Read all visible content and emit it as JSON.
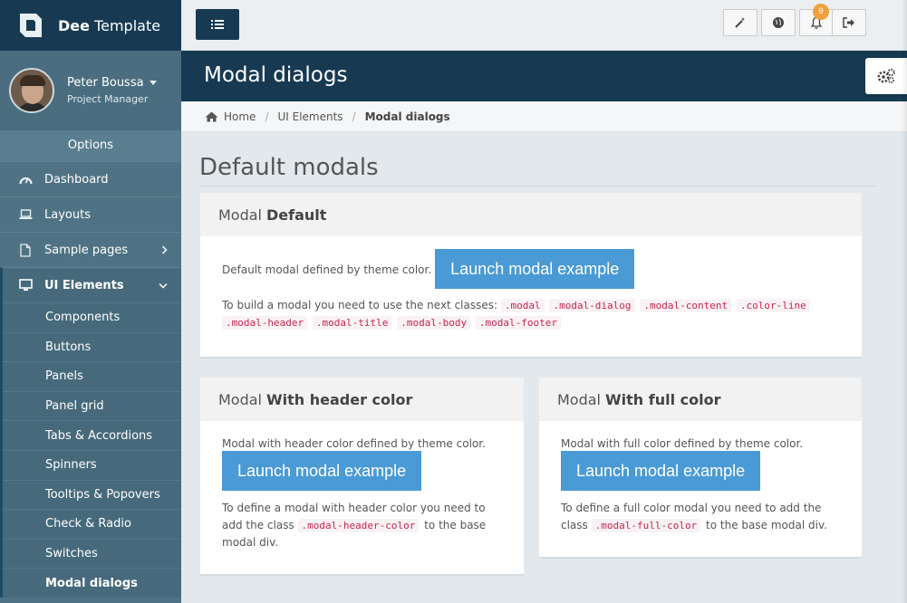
{
  "brand": {
    "name_bold": "Dee",
    "name_rest": " Template"
  },
  "profile": {
    "name": "Peter Boussa",
    "role": "Project Manager"
  },
  "sidebar": {
    "options_label": "Options",
    "items": [
      {
        "label": "Dashboard",
        "icon": "dashboard-icon"
      },
      {
        "label": "Layouts",
        "icon": "laptop-icon"
      },
      {
        "label": "Sample pages",
        "icon": "file-icon"
      },
      {
        "label": "UI Elements",
        "icon": "monitor-icon"
      }
    ],
    "sub_items": [
      "Components",
      "Buttons",
      "Panels",
      "Panel grid",
      "Tabs & Accordions",
      "Spinners",
      "Tooltips & Popovers",
      "Check & Radio",
      "Switches",
      "Modal dialogs"
    ]
  },
  "topbar": {
    "notification_count": "9"
  },
  "page": {
    "title": "Modal dialogs"
  },
  "breadcrumb": {
    "home": "Home",
    "parent": "UI Elements",
    "current": "Modal dialogs"
  },
  "content": {
    "section_title": "Default modals",
    "panel_default": {
      "title_light": "Modal",
      "title_bold": "Default",
      "intro": "Default modal defined by theme color.",
      "button": "Launch modal example",
      "classes_intro": "To build a modal you need to use the next classes:",
      "classes": [
        ".modal",
        ".modal-dialog",
        ".modal-content",
        ".color-line",
        ".modal-header",
        ".modal-title",
        ".modal-body",
        ".modal-footer"
      ]
    },
    "panel_header": {
      "title_light": "Modal",
      "title_bold": "With header color",
      "intro": "Modal with header color defined by theme color.",
      "button": "Launch modal example",
      "desc_before": "To define a modal with header color you need to add the class",
      "code": ".modal-header-color",
      "desc_after": "to the base modal div."
    },
    "panel_full": {
      "title_light": "Modal",
      "title_bold": "With full color",
      "intro": "Modal with full color defined by theme color.",
      "button": "Launch modal example",
      "desc_before": "To define a full color modal you need to add the class",
      "code": ".modal-full-color",
      "desc_after": "to the base modal div."
    }
  },
  "colors": {
    "sidebar_bg": "#4f7384",
    "brand_dark": "#173a52",
    "primary_button": "#4a9ad5",
    "badge": "#f0a03c",
    "code_text": "#c7254e"
  }
}
